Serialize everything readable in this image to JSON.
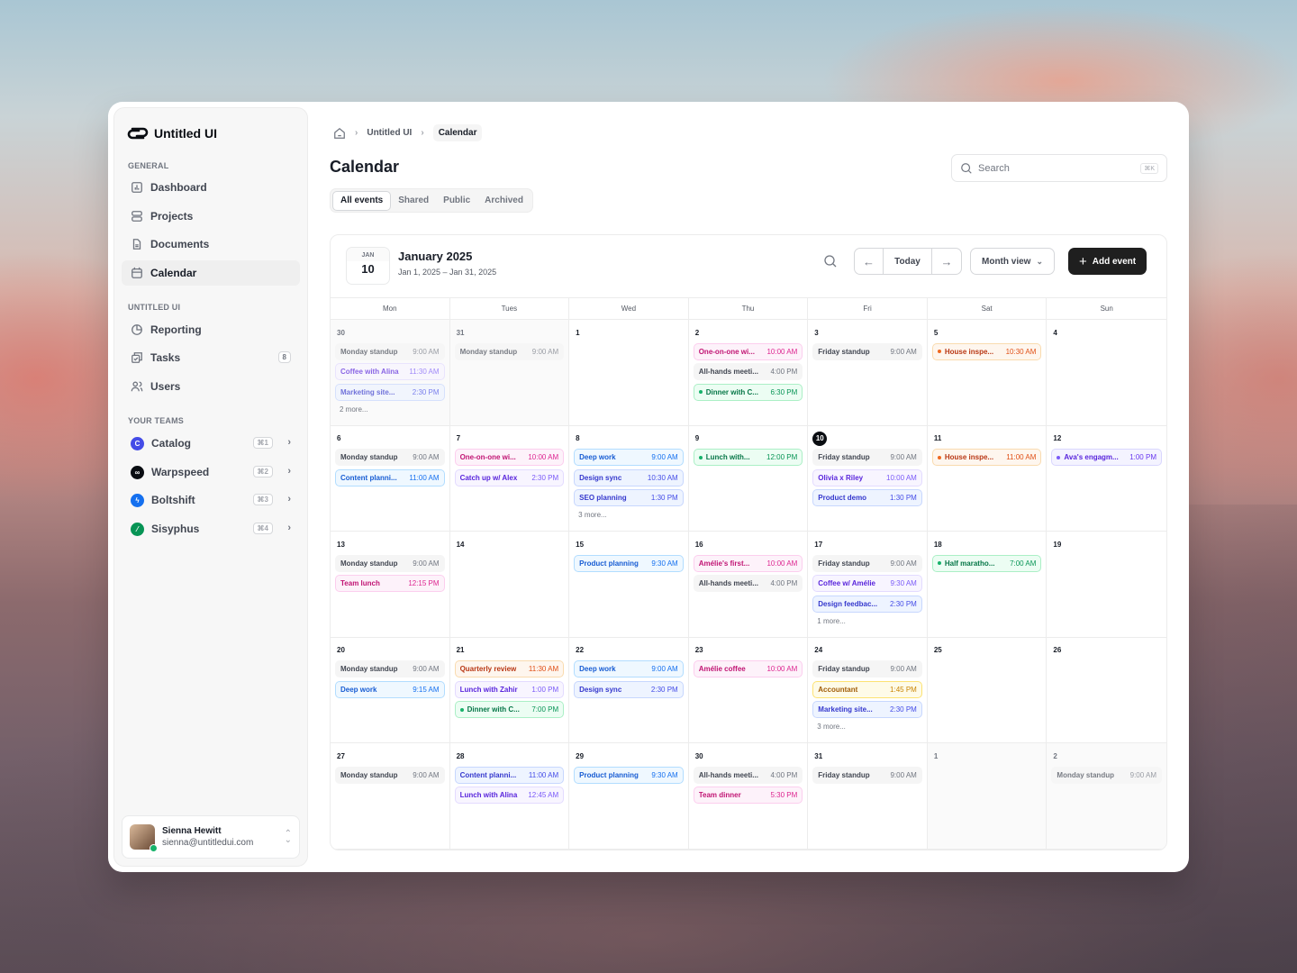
{
  "brand": {
    "name": "Untitled UI"
  },
  "sidebar": {
    "sections": {
      "general": "GENERAL",
      "untitled": "UNTITLED UI",
      "teams": "YOUR TEAMS"
    },
    "general": [
      {
        "label": "Dashboard",
        "icon": "dashboard-icon"
      },
      {
        "label": "Projects",
        "icon": "projects-icon"
      },
      {
        "label": "Documents",
        "icon": "documents-icon"
      },
      {
        "label": "Calendar",
        "icon": "calendar-icon",
        "active": true
      }
    ],
    "untitled": [
      {
        "label": "Reporting",
        "icon": "reporting-icon"
      },
      {
        "label": "Tasks",
        "icon": "tasks-icon",
        "badge": "8"
      },
      {
        "label": "Users",
        "icon": "users-icon"
      }
    ],
    "teams": [
      {
        "label": "Catalog",
        "shortcut": "⌘1",
        "color": "#444ce7"
      },
      {
        "label": "Warpspeed",
        "shortcut": "⌘2",
        "color": "#0a0d12"
      },
      {
        "label": "Boltshift",
        "shortcut": "⌘3",
        "color": "#1570ef"
      },
      {
        "label": "Sisyphus",
        "shortcut": "⌘4",
        "color": "#079455"
      }
    ],
    "user": {
      "name": "Sienna Hewitt",
      "email": "sienna@untitledui.com"
    }
  },
  "breadcrumb": {
    "items": [
      "Untitled UI",
      "Calendar"
    ]
  },
  "page": {
    "title": "Calendar"
  },
  "tabs": [
    {
      "label": "All events",
      "active": true
    },
    {
      "label": "Shared"
    },
    {
      "label": "Public"
    },
    {
      "label": "Archived"
    }
  ],
  "search": {
    "placeholder": "Search",
    "shortcut": "⌘K"
  },
  "calendar": {
    "date_badge": {
      "month": "JAN",
      "day": "10"
    },
    "title": "January 2025",
    "range": "Jan 1, 2025 – Jan 31, 2025",
    "today_label": "Today",
    "view_label": "Month view",
    "add_label": "Add event",
    "weekdays": [
      "Mon",
      "Tues",
      "Wed",
      "Thu",
      "Fri",
      "Sat",
      "Sun"
    ],
    "days": [
      {
        "n": "30",
        "muted": true,
        "events": [
          {
            "t": "Monday standup",
            "tm": "9:00 AM",
            "c": "gray"
          },
          {
            "t": "Coffee with Alina",
            "tm": "11:30 AM",
            "c": "purple"
          },
          {
            "t": "Marketing site...",
            "tm": "2:30 PM",
            "c": "indigo"
          }
        ],
        "more": "2 more..."
      },
      {
        "n": "31",
        "muted": true,
        "events": [
          {
            "t": "Monday standup",
            "tm": "9:00 AM",
            "c": "gray"
          }
        ]
      },
      {
        "n": "1",
        "events": []
      },
      {
        "n": "2",
        "events": [
          {
            "t": "One-on-one wi...",
            "tm": "10:00 AM",
            "c": "pink"
          },
          {
            "t": "All-hands meeti...",
            "tm": "4:00 PM",
            "c": "gray"
          },
          {
            "t": "Dinner with C...",
            "tm": "6:30 PM",
            "c": "green",
            "dot": true
          }
        ]
      },
      {
        "n": "3",
        "events": [
          {
            "t": "Friday standup",
            "tm": "9:00 AM",
            "c": "gray"
          }
        ]
      },
      {
        "n": "5",
        "events": [
          {
            "t": "House inspe...",
            "tm": "10:30 AM",
            "c": "orange",
            "dot": true
          }
        ]
      },
      {
        "n": "4",
        "events": []
      },
      {
        "n": "6",
        "events": [
          {
            "t": "Monday standup",
            "tm": "9:00 AM",
            "c": "gray"
          },
          {
            "t": "Content planni...",
            "tm": "11:00 AM",
            "c": "blue"
          }
        ]
      },
      {
        "n": "7",
        "events": [
          {
            "t": "One-on-one wi...",
            "tm": "10:00 AM",
            "c": "pink"
          },
          {
            "t": "Catch up w/ Alex",
            "tm": "2:30 PM",
            "c": "purple"
          }
        ]
      },
      {
        "n": "8",
        "events": [
          {
            "t": "Deep work",
            "tm": "9:00 AM",
            "c": "blue"
          },
          {
            "t": "Design sync",
            "tm": "10:30 AM",
            "c": "indigo"
          },
          {
            "t": "SEO planning",
            "tm": "1:30 PM",
            "c": "indigo"
          }
        ],
        "more": "3 more..."
      },
      {
        "n": "9",
        "events": [
          {
            "t": "Lunch with...",
            "tm": "12:00 PM",
            "c": "green",
            "dot": true
          }
        ]
      },
      {
        "n": "10",
        "today": true,
        "events": [
          {
            "t": "Friday standup",
            "tm": "9:00 AM",
            "c": "gray"
          },
          {
            "t": "Olivia x Riley",
            "tm": "10:00 AM",
            "c": "purple"
          },
          {
            "t": "Product demo",
            "tm": "1:30 PM",
            "c": "indigo"
          }
        ]
      },
      {
        "n": "11",
        "events": [
          {
            "t": "House inspe...",
            "tm": "11:00 AM",
            "c": "orange",
            "dot": true
          }
        ]
      },
      {
        "n": "12",
        "events": [
          {
            "t": "Ava's engagm...",
            "tm": "1:00 PM",
            "c": "violet",
            "dot": true
          }
        ]
      },
      {
        "n": "13",
        "events": [
          {
            "t": "Monday standup",
            "tm": "9:00 AM",
            "c": "gray"
          },
          {
            "t": "Team lunch",
            "tm": "12:15 PM",
            "c": "pink"
          }
        ]
      },
      {
        "n": "14",
        "events": []
      },
      {
        "n": "15",
        "events": [
          {
            "t": "Product planning",
            "tm": "9:30 AM",
            "c": "blue"
          }
        ]
      },
      {
        "n": "16",
        "events": [
          {
            "t": "Amélie's first...",
            "tm": "10:00 AM",
            "c": "pink"
          },
          {
            "t": "All-hands meeti...",
            "tm": "4:00 PM",
            "c": "gray"
          }
        ]
      },
      {
        "n": "17",
        "events": [
          {
            "t": "Friday standup",
            "tm": "9:00 AM",
            "c": "gray"
          },
          {
            "t": "Coffee w/ Amélie",
            "tm": "9:30 AM",
            "c": "purple"
          },
          {
            "t": "Design feedbac...",
            "tm": "2:30 PM",
            "c": "indigo"
          }
        ],
        "more": "1 more..."
      },
      {
        "n": "18",
        "events": [
          {
            "t": "Half maratho...",
            "tm": "7:00 AM",
            "c": "green",
            "dot": true
          }
        ]
      },
      {
        "n": "19",
        "events": []
      },
      {
        "n": "20",
        "events": [
          {
            "t": "Monday standup",
            "tm": "9:00 AM",
            "c": "gray"
          },
          {
            "t": "Deep work",
            "tm": "9:15 AM",
            "c": "blue"
          }
        ]
      },
      {
        "n": "21",
        "events": [
          {
            "t": "Quarterly review",
            "tm": "11:30 AM",
            "c": "orange"
          },
          {
            "t": "Lunch with Zahir",
            "tm": "1:00 PM",
            "c": "purple"
          },
          {
            "t": "Dinner with C...",
            "tm": "7:00 PM",
            "c": "green",
            "dot": true
          }
        ]
      },
      {
        "n": "22",
        "events": [
          {
            "t": "Deep work",
            "tm": "9:00 AM",
            "c": "blue"
          },
          {
            "t": "Design sync",
            "tm": "2:30 PM",
            "c": "indigo"
          }
        ]
      },
      {
        "n": "23",
        "events": [
          {
            "t": "Amélie coffee",
            "tm": "10:00 AM",
            "c": "pink"
          }
        ]
      },
      {
        "n": "24",
        "events": [
          {
            "t": "Friday standup",
            "tm": "9:00 AM",
            "c": "gray"
          },
          {
            "t": "Accountant",
            "tm": "1:45 PM",
            "c": "yellow"
          },
          {
            "t": "Marketing site...",
            "tm": "2:30 PM",
            "c": "indigo"
          }
        ],
        "more": "3 more..."
      },
      {
        "n": "25",
        "events": []
      },
      {
        "n": "26",
        "events": []
      },
      {
        "n": "27",
        "events": [
          {
            "t": "Monday standup",
            "tm": "9:00 AM",
            "c": "gray"
          }
        ]
      },
      {
        "n": "28",
        "events": [
          {
            "t": "Content planni...",
            "tm": "11:00 AM",
            "c": "indigo"
          },
          {
            "t": "Lunch with Alina",
            "tm": "12:45 AM",
            "c": "purple"
          }
        ]
      },
      {
        "n": "29",
        "events": [
          {
            "t": "Product planning",
            "tm": "9:30 AM",
            "c": "blue"
          }
        ]
      },
      {
        "n": "30",
        "events": [
          {
            "t": "All-hands meeti...",
            "tm": "4:00 PM",
            "c": "gray"
          },
          {
            "t": "Team dinner",
            "tm": "5:30 PM",
            "c": "pink"
          }
        ]
      },
      {
        "n": "31",
        "events": [
          {
            "t": "Friday standup",
            "tm": "9:00 AM",
            "c": "gray"
          }
        ]
      },
      {
        "n": "1",
        "muted": true,
        "events": []
      },
      {
        "n": "2",
        "muted": true,
        "events": [
          {
            "t": "Monday standup",
            "tm": "9:00 AM",
            "c": "gray"
          }
        ]
      }
    ]
  }
}
